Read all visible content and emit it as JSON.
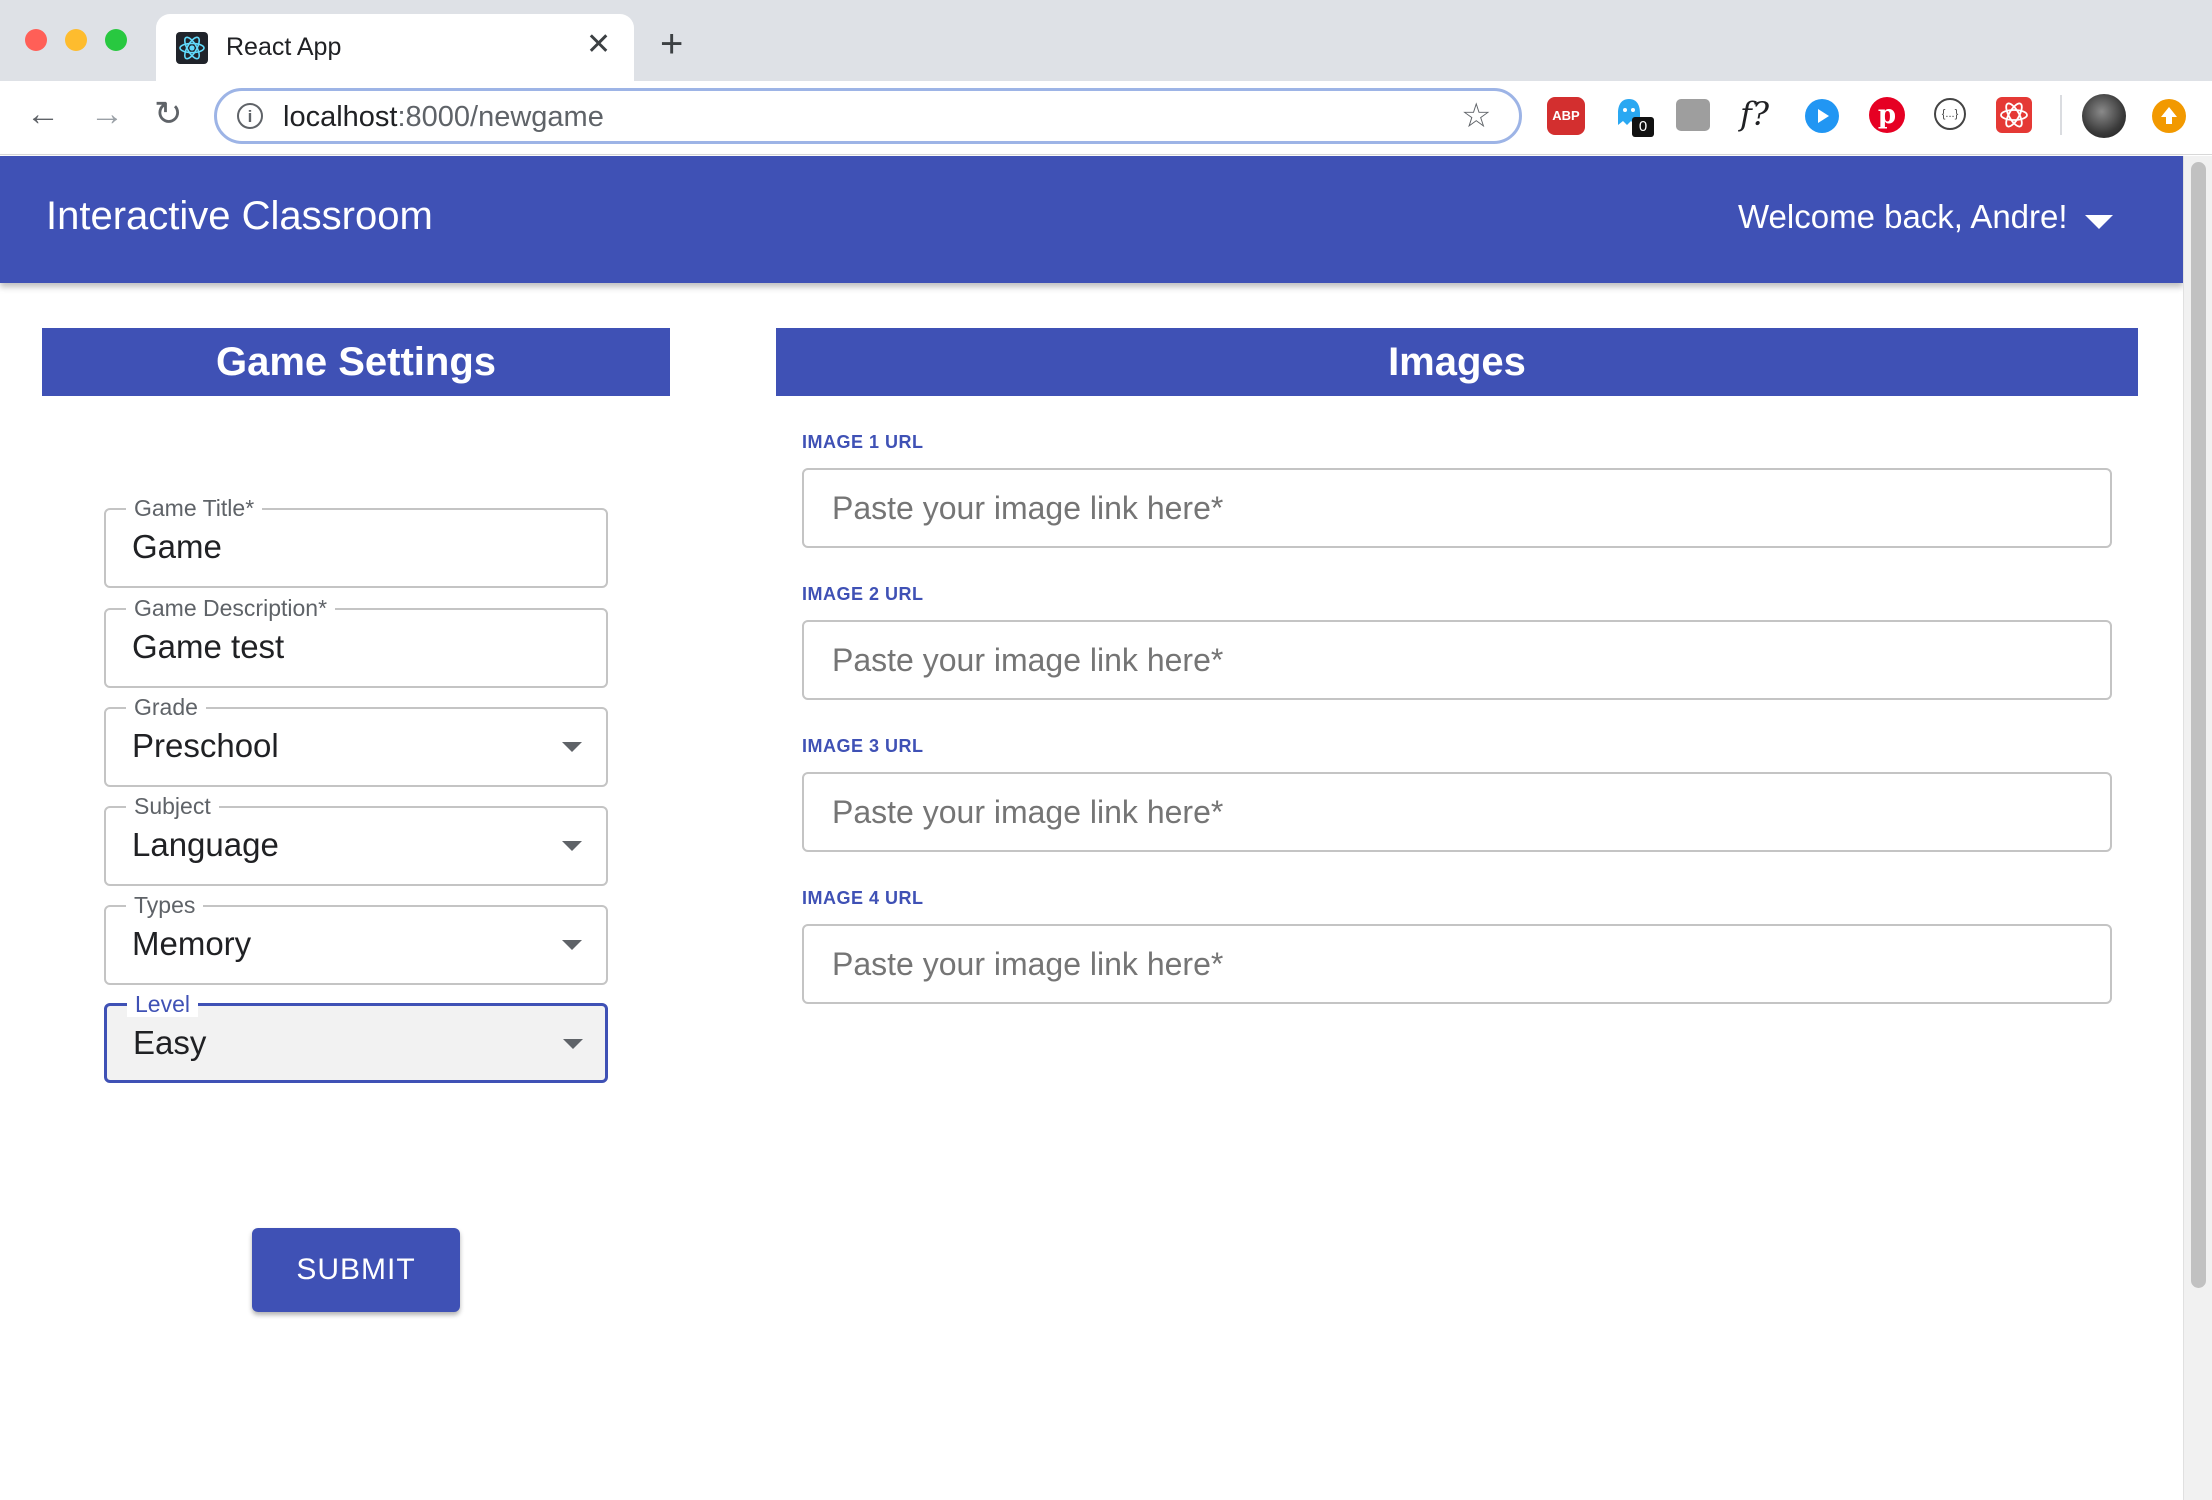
{
  "browser": {
    "tab_title": "React App",
    "close_glyph": "✕",
    "new_tab_glyph": "+",
    "url_host": "localhost",
    "url_path": ":8000/newgame",
    "extensions": {
      "abp": "ABP",
      "ghostery_badge": "0",
      "formula": "f?",
      "placeholder_glyph": "{...}"
    }
  },
  "app": {
    "title": "Interactive Classroom",
    "welcome": "Welcome back, Andre!",
    "primary_color": "#3f51b5"
  },
  "settings": {
    "heading": "Game Settings",
    "fields": [
      {
        "label": "Game Title",
        "required": "*",
        "value": "Game"
      },
      {
        "label": "Game Description",
        "required": "*",
        "value": "Game test"
      },
      {
        "label": "Grade",
        "value": "Preschool"
      },
      {
        "label": "Subject",
        "value": "Language"
      },
      {
        "label": "Types",
        "value": "Memory"
      },
      {
        "label": "Level",
        "value": "Easy"
      }
    ],
    "submit_label": "SUBMIT"
  },
  "images": {
    "heading": "Images",
    "inputs": [
      {
        "label": "IMAGE 1 URL",
        "placeholder": "Paste your image link here",
        "required": "*"
      },
      {
        "label": "IMAGE 2 URL",
        "placeholder": "Paste your image link here",
        "required": "*"
      },
      {
        "label": "IMAGE 3 URL",
        "placeholder": "Paste your image link here",
        "required": "*"
      },
      {
        "label": "IMAGE 4 URL",
        "placeholder": "Paste your image link here",
        "required": "*"
      }
    ]
  }
}
